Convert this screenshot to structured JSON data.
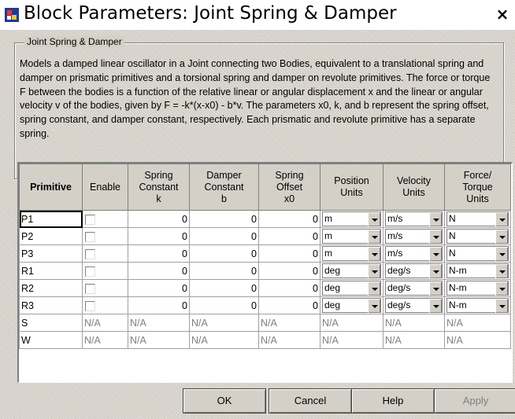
{
  "window": {
    "title": "Block Parameters: Joint Spring & Damper",
    "close_glyph": "×",
    "icon": "simulink-block-icon"
  },
  "group": {
    "legend": "Joint Spring & Damper",
    "description": "Models a damped linear oscillator in a Joint connecting two Bodies, equivalent to a translational spring and damper on prismatic primitives and a torsional spring and damper on revolute primitives. The force or torque F between the bodies is a function of the relative linear or angular displacement x and the linear or angular velocity v of the bodies, given by F = -k*(x-x0) - b*v. The parameters x0, k, and b represent the spring offset, spring constant, and damper constant, respectively. Each prismatic and revolute primitive has a separate spring."
  },
  "table": {
    "headers": {
      "primitive": "Primitive",
      "enable": "Enable",
      "spring_constant": [
        "Spring",
        "Constant",
        "k"
      ],
      "damper_constant": [
        "Damper",
        "Constant",
        "b"
      ],
      "spring_offset": [
        "Spring",
        "Offset",
        "x0"
      ],
      "position_units": [
        "Position",
        "Units"
      ],
      "velocity_units": [
        "Velocity",
        "Units"
      ],
      "force_units": [
        "Force/",
        "Torque",
        "Units"
      ]
    },
    "rows": [
      {
        "name": "P1",
        "enabled": false,
        "k": "0",
        "b": "0",
        "x0": "0",
        "pos": "m",
        "vel": "m/s",
        "force": "N"
      },
      {
        "name": "P2",
        "enabled": false,
        "k": "0",
        "b": "0",
        "x0": "0",
        "pos": "m",
        "vel": "m/s",
        "force": "N"
      },
      {
        "name": "P3",
        "enabled": false,
        "k": "0",
        "b": "0",
        "x0": "0",
        "pos": "m",
        "vel": "m/s",
        "force": "N"
      },
      {
        "name": "R1",
        "enabled": false,
        "k": "0",
        "b": "0",
        "x0": "0",
        "pos": "deg",
        "vel": "deg/s",
        "force": "N-m"
      },
      {
        "name": "R2",
        "enabled": false,
        "k": "0",
        "b": "0",
        "x0": "0",
        "pos": "deg",
        "vel": "deg/s",
        "force": "N-m"
      },
      {
        "name": "R3",
        "enabled": false,
        "k": "0",
        "b": "0",
        "x0": "0",
        "pos": "deg",
        "vel": "deg/s",
        "force": "N-m"
      }
    ],
    "na_rows": [
      {
        "name": "S",
        "value": "N/A"
      },
      {
        "name": "W",
        "value": "N/A"
      }
    ]
  },
  "buttons": {
    "ok": "OK",
    "cancel": "Cancel",
    "help": "Help",
    "apply": "Apply"
  },
  "colors": {
    "dialog_bg": "#d4d0c8",
    "disabled_text": "#808080"
  }
}
